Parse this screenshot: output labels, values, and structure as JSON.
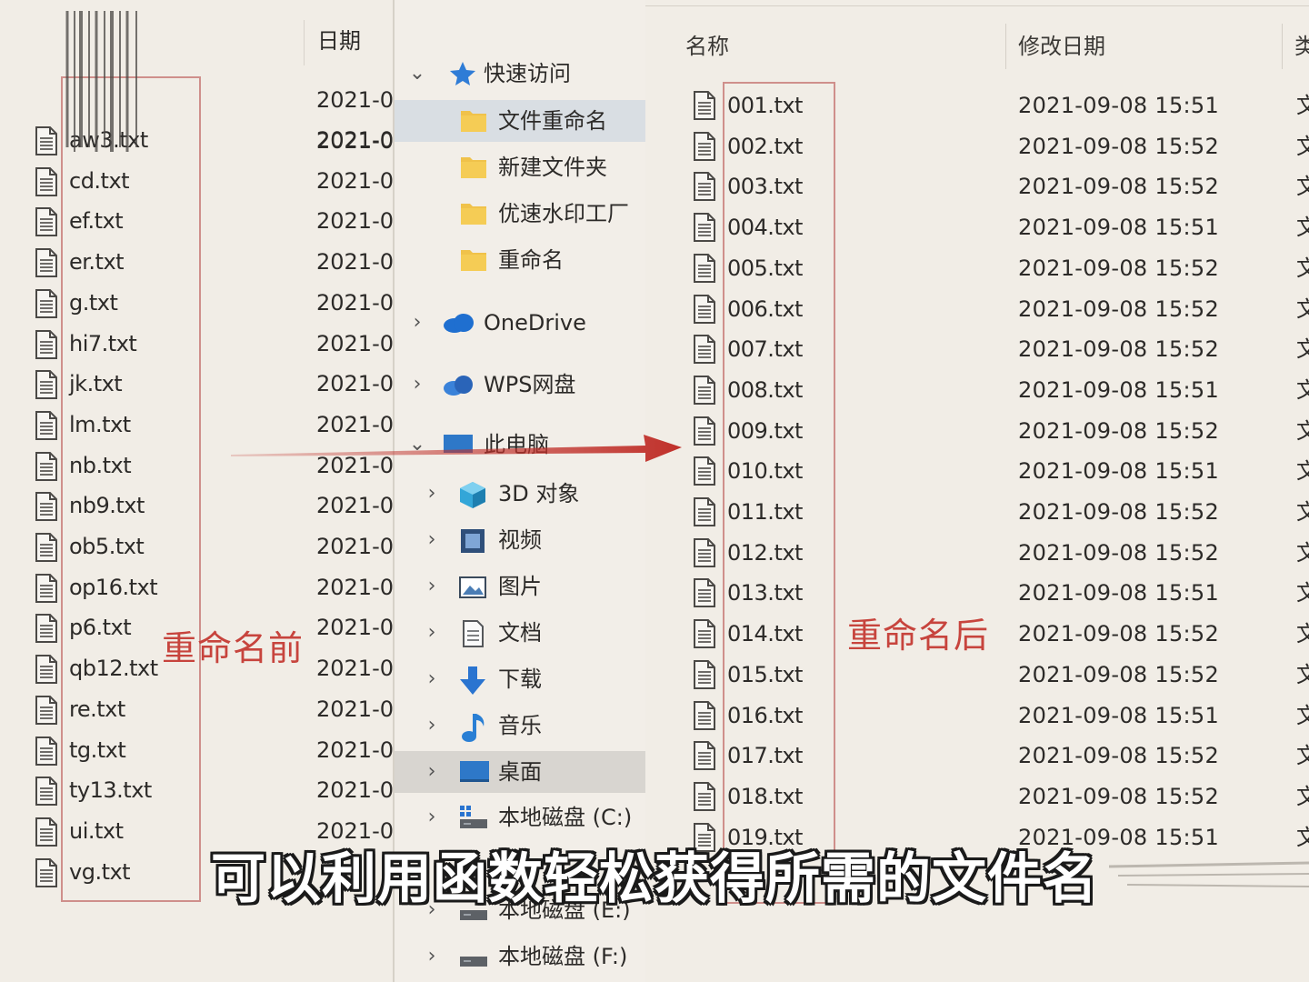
{
  "left_pane": {
    "date_header": "日期",
    "files": [
      {
        "name": "aw3.txt",
        "date": "2021-0"
      },
      {
        "name": "cd.txt",
        "date": "2021-0"
      },
      {
        "name": "ef.txt",
        "date": "2021-0"
      },
      {
        "name": "er.txt",
        "date": "2021-0"
      },
      {
        "name": "g.txt",
        "date": "2021-0"
      },
      {
        "name": "hi7.txt",
        "date": "2021-0"
      },
      {
        "name": "jk.txt",
        "date": "2021-0"
      },
      {
        "name": "lm.txt",
        "date": "2021-0"
      },
      {
        "name": "nb.txt",
        "date": "2021-0"
      },
      {
        "name": "nb9.txt",
        "date": "2021-0"
      },
      {
        "name": "ob5.txt",
        "date": "2021-0"
      },
      {
        "name": "op16.txt",
        "date": "2021-0"
      },
      {
        "name": "p6.txt",
        "date": "2021-0"
      },
      {
        "name": "qb12.txt",
        "date": "2021-0"
      },
      {
        "name": "re.txt",
        "date": "2021-0"
      },
      {
        "name": "tg.txt",
        "date": "2021-0"
      },
      {
        "name": "ty13.txt",
        "date": "2021-0"
      },
      {
        "name": "ui.txt",
        "date": "2021-0"
      },
      {
        "name": "vg.txt",
        "date": ""
      }
    ],
    "extra_dates": [
      "2021-0",
      "2021-0"
    ],
    "annotation": "重命名前"
  },
  "nav": {
    "quick_access": "快速访问",
    "items": [
      {
        "label": "文件重命名",
        "icon": "folder-icon"
      },
      {
        "label": "新建文件夹",
        "icon": "folder-icon"
      },
      {
        "label": "优速水印工厂",
        "icon": "folder-icon"
      },
      {
        "label": "重命名",
        "icon": "folder-icon"
      }
    ],
    "onedrive": "OneDrive",
    "wps": "WPS网盘",
    "this_pc": "此电脑",
    "pc_items": [
      {
        "label": "3D 对象",
        "icon": "cube-icon"
      },
      {
        "label": "视频",
        "icon": "video-icon"
      },
      {
        "label": "图片",
        "icon": "picture-icon"
      },
      {
        "label": "文档",
        "icon": "document-icon"
      },
      {
        "label": "下载",
        "icon": "download-icon"
      },
      {
        "label": "音乐",
        "icon": "music-icon"
      },
      {
        "label": "桌面",
        "icon": "desktop-icon"
      }
    ],
    "drives": [
      {
        "label": "本地磁盘 (C:)"
      },
      {
        "label": "本地磁盘 (E:)"
      },
      {
        "label": "本地磁盘 (F:)"
      }
    ]
  },
  "right_pane": {
    "headers": {
      "name": "名称",
      "modified": "修改日期",
      "type": "类"
    },
    "files": [
      {
        "name": "001.txt",
        "date": "2021-09-08 15:51",
        "type": "文"
      },
      {
        "name": "002.txt",
        "date": "2021-09-08 15:52",
        "type": "文"
      },
      {
        "name": "003.txt",
        "date": "2021-09-08 15:52",
        "type": "文"
      },
      {
        "name": "004.txt",
        "date": "2021-09-08 15:51",
        "type": "文"
      },
      {
        "name": "005.txt",
        "date": "2021-09-08 15:52",
        "type": "文"
      },
      {
        "name": "006.txt",
        "date": "2021-09-08 15:52",
        "type": "文"
      },
      {
        "name": "007.txt",
        "date": "2021-09-08 15:52",
        "type": "文"
      },
      {
        "name": "008.txt",
        "date": "2021-09-08 15:51",
        "type": "文"
      },
      {
        "name": "009.txt",
        "date": "2021-09-08 15:52",
        "type": "文"
      },
      {
        "name": "010.txt",
        "date": "2021-09-08 15:51",
        "type": "文"
      },
      {
        "name": "011.txt",
        "date": "2021-09-08 15:52",
        "type": "文"
      },
      {
        "name": "012.txt",
        "date": "2021-09-08 15:52",
        "type": "文"
      },
      {
        "name": "013.txt",
        "date": "2021-09-08 15:51",
        "type": "文"
      },
      {
        "name": "014.txt",
        "date": "2021-09-08 15:52",
        "type": "文"
      },
      {
        "name": "015.txt",
        "date": "2021-09-08 15:52",
        "type": "文"
      },
      {
        "name": "016.txt",
        "date": "2021-09-08 15:51",
        "type": "文"
      },
      {
        "name": "017.txt",
        "date": "2021-09-08 15:52",
        "type": "文"
      },
      {
        "name": "018.txt",
        "date": "2021-09-08 15:52",
        "type": "文"
      },
      {
        "name": "019.txt",
        "date": "2021-09-08 15:51",
        "type": "文"
      }
    ],
    "annotation": "重命名后"
  },
  "subtitle": "可以利用函数轻松获得所需的文件名",
  "colors": {
    "annotation_red": "#c7443d",
    "arrow_red": "#c0302a",
    "selected_bg": "#d9dee3"
  }
}
